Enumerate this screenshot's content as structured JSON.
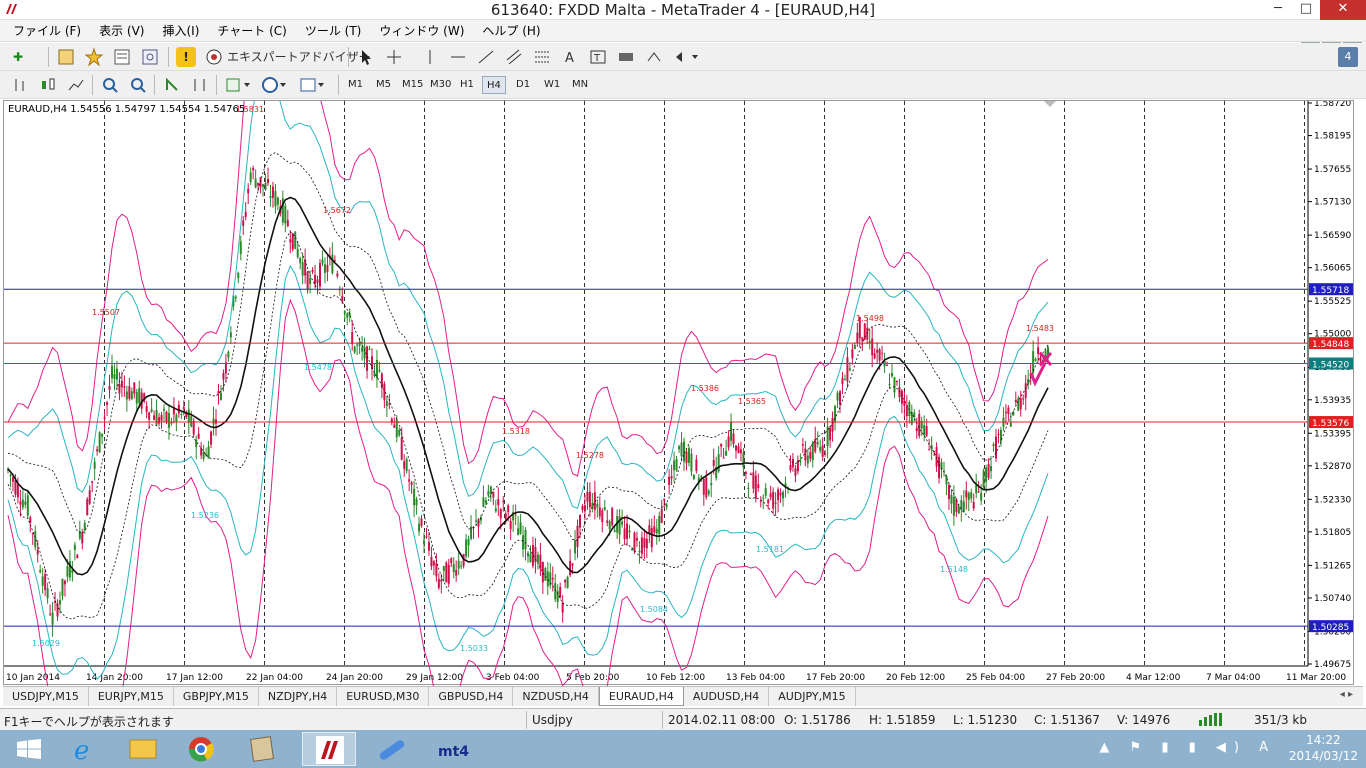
{
  "window": {
    "title": "613640: FXDD Malta - MetaTrader 4 - [EURAUD,H4]",
    "minimize": "─",
    "maximize": "□",
    "close": "✕"
  },
  "menu": [
    "ファイル (F)",
    "表示 (V)",
    "挿入(I)",
    "チャート (C)",
    "ツール (T)",
    "ウィンドウ (W)",
    "ヘルプ (H)"
  ],
  "child_buttons": {
    "minimize": "_",
    "restore": "❐",
    "close": "✕"
  },
  "toolbar1": {
    "expert_advisor_label": "エキスパートアドバイザー",
    "new_order": "✚",
    "alert": "!"
  },
  "timeframes": [
    "M1",
    "M5",
    "M15",
    "M30",
    "H1",
    "H4",
    "D1",
    "W1",
    "MN"
  ],
  "active_timeframe": "H4",
  "window_count": "4",
  "chart": {
    "symbol_label": "EURAUD,H4  1.54556 1.54797 1.54554 1.54765",
    "price_ticks": [
      "1.58720",
      "1.58195",
      "1.57655",
      "1.57130",
      "1.56590",
      "1.56065",
      "1.55525",
      "1.55000",
      "1.54460",
      "1.53935",
      "1.53395",
      "1.52870",
      "1.52330",
      "1.51805",
      "1.51265",
      "1.50740",
      "1.50200",
      "1.49675"
    ],
    "time_ticks": [
      "10 Jan 2014",
      "14 Jan 20:00",
      "17 Jan 12:00",
      "22 Jan 04:00",
      "24 Jan 20:00",
      "29 Jan 12:00",
      "3 Feb 04:00",
      "5 Feb 20:00",
      "10 Feb 12:00",
      "13 Feb 04:00",
      "17 Feb 20:00",
      "20 Feb 12:00",
      "25 Feb 04:00",
      "27 Feb 20:00",
      "4 Mar 12:00",
      "7 Mar 04:00",
      "11 Mar 20:00"
    ],
    "hlines": [
      {
        "price": "1.55718",
        "color": "#1f1fbf"
      },
      {
        "price": "1.54848",
        "color": "#e02020"
      },
      {
        "price": "1.54520",
        "color": "#0e7d7d"
      },
      {
        "price": "1.53576",
        "color": "#e02020"
      },
      {
        "price": "1.50285",
        "color": "#1f1fbf"
      }
    ],
    "hlines_hidden_label": "1.54765",
    "high_labels": [
      "1.5831",
      "1.5672",
      "1.5507",
      "1.5498",
      "1.5483",
      "1.5386",
      "1.5365",
      "1.5318",
      "1.5278"
    ],
    "low_labels": [
      "1.5029",
      "1.5236",
      "1.5478",
      "1.5033",
      "1.5084",
      "1.5181",
      "1.5148"
    ],
    "colors": {
      "bull": "#2a8a2a",
      "bear": "#d0104a",
      "outer_band": "#e0208a",
      "inner_band": "#2ab5c0",
      "mid": "#111111",
      "dotted": "#111111",
      "grid": "#000000",
      "high_label": "#e02020",
      "low_label": "#25c0d0"
    }
  },
  "tabs": [
    "USDJPY,M15",
    "EURJPY,M15",
    "GBPJPY,M15",
    "NZDJPY,H4",
    "EURUSD,M30",
    "GBPUSD,H4",
    "NZDUSD,H4",
    "EURAUD,H4",
    "AUDUSD,H4",
    "AUDJPY,M15"
  ],
  "active_tab": "EURAUD,H4",
  "tab_arrows": "◂ ▸",
  "status": {
    "help": "F1キーでヘルプが表示されます",
    "profile": "Usdjpy",
    "time": "2014.02.11 08:00",
    "open": "O: 1.51786",
    "high": "H: 1.51859",
    "low": "L: 1.51230",
    "close": "C: 1.51367",
    "volume": "V: 14976",
    "traffic": "351/3 kb"
  },
  "taskbar": {
    "time": "14:22",
    "date": "2014/03/12",
    "apps": [
      "windows-icon",
      "ie-icon",
      "explorer-icon",
      "chrome-icon",
      "tools-icon",
      "fxdd-icon",
      "pen-icon",
      "mt4-icon"
    ],
    "tray": "▲ ⚑ ▮ ▮ ◀) A"
  }
}
